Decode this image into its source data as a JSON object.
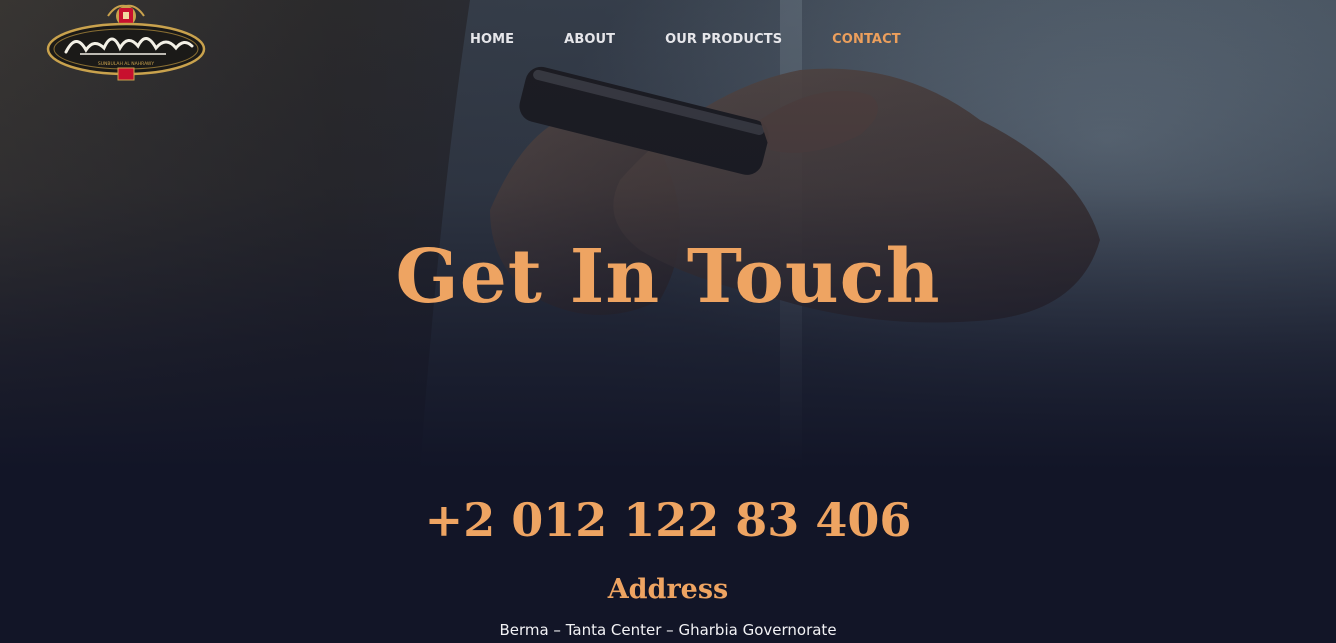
{
  "brand": {
    "logo_alt": "Sunbulah Al Nahrawy",
    "logo_caption": "SUNBULAH AL NAHRAWY"
  },
  "nav": {
    "items": [
      {
        "label": "HOME"
      },
      {
        "label": "ABOUT"
      },
      {
        "label": "OUR PRODUCTS"
      },
      {
        "label": "CONTACT",
        "active": true
      }
    ]
  },
  "hero": {
    "title": "Get In Touch"
  },
  "contact": {
    "phone": "+2 012 122 83 406",
    "address_heading": "Address",
    "address": "Berma – Tanta Center – Gharbia Governorate"
  },
  "colors": {
    "accent": "#eea462",
    "background": "#121527",
    "nav_text": "#e6e6ea",
    "body_text": "#f2f2f5",
    "logo_gold": "#c9a24d",
    "logo_red": "#c8102e"
  }
}
